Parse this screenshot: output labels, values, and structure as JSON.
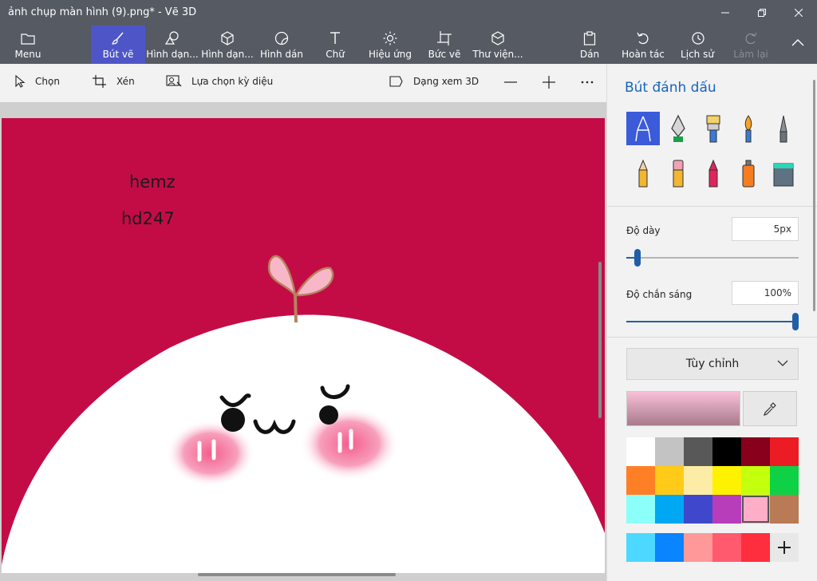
{
  "window": {
    "title": "ảnh chụp màn hình (9).png* - Vẽ 3D"
  },
  "ribbon": {
    "menu": "Menu",
    "brushes": "Bút vẽ",
    "shapes_2d": "Hình dạn...",
    "shapes_3d": "Hình dạn...",
    "stickers": "Hình dán",
    "text": "Chữ",
    "effects": "Hiệu ứng",
    "canvas": "Bức vẽ",
    "library": "Thư viện...",
    "paste": "Dán",
    "undo": "Hoàn tác",
    "history": "Lịch sử",
    "redo": "Làm lại"
  },
  "commands": {
    "select": "Chọn",
    "crop": "Xén",
    "magic_select": "Lựa chọn kỳ diệu",
    "view_3d": "Dạng xem 3D"
  },
  "canvas": {
    "text1": "hemz",
    "text2": "hd247",
    "background_color": "#c30c45"
  },
  "panel": {
    "title": "Bút đánh dấu",
    "thickness_label": "Độ dày",
    "thickness_value": "5px",
    "thickness_fraction": 0.05,
    "opacity_label": "Độ chắn sáng",
    "opacity_value": "100%",
    "opacity_fraction": 1.0,
    "custom_label": "Tùy chỉnh",
    "brushes": [
      "marker",
      "calligraphy-pen",
      "oil-brush",
      "watercolor",
      "pixel-pen",
      "pencil",
      "eraser",
      "crayon",
      "spray-can",
      "fill-bucket"
    ],
    "palette": [
      "#ffffff",
      "#c3c3c3",
      "#585858",
      "#000000",
      "#88001b",
      "#ec1c24",
      "#ff7f27",
      "#ffca18",
      "#fdeca6",
      "#fff200",
      "#c4ff0e",
      "#0ed145",
      "#8cfffb",
      "#00a8f3",
      "#3f48cc",
      "#b83dba",
      "#ffaec8",
      "#b97a56"
    ],
    "selected_color": "#ffaec8",
    "recent_colors": [
      "#4dd9ff",
      "#0a84ff",
      "#ff9999",
      "#ff5a6e",
      "#ff2e3e"
    ]
  }
}
